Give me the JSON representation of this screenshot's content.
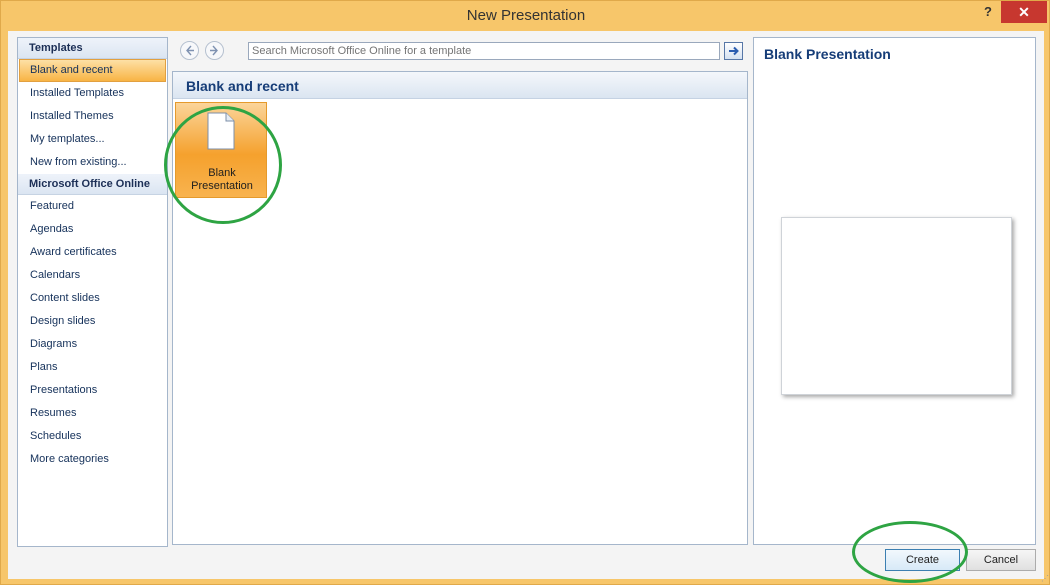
{
  "window": {
    "title": "New Presentation",
    "help_label": "?",
    "close_label": "✕"
  },
  "sidebar": {
    "section_templates": "Templates",
    "items_local": [
      {
        "label": "Blank and recent",
        "selected": true
      },
      {
        "label": "Installed Templates"
      },
      {
        "label": "Installed Themes"
      },
      {
        "label": "My templates..."
      },
      {
        "label": "New from existing..."
      }
    ],
    "section_online": "Microsoft Office Online",
    "items_online": [
      {
        "label": "Featured"
      },
      {
        "label": "Agendas"
      },
      {
        "label": "Award certificates"
      },
      {
        "label": "Calendars"
      },
      {
        "label": "Content slides"
      },
      {
        "label": "Design slides"
      },
      {
        "label": "Diagrams"
      },
      {
        "label": "Plans"
      },
      {
        "label": "Presentations"
      },
      {
        "label": "Resumes"
      },
      {
        "label": "Schedules"
      },
      {
        "label": "More categories"
      }
    ]
  },
  "toolbar": {
    "back_icon": "arrow-left-icon",
    "forward_icon": "arrow-right-icon",
    "search_placeholder": "Search Microsoft Office Online for a template",
    "search_go_icon": "search-go-arrow-icon"
  },
  "gallery": {
    "heading": "Blank and recent",
    "tiles": [
      {
        "label": "Blank Presentation",
        "icon": "blank-document-icon",
        "selected": true
      }
    ]
  },
  "preview": {
    "title": "Blank Presentation"
  },
  "footer": {
    "create_label": "Create",
    "cancel_label": "Cancel"
  },
  "colors": {
    "accent_orange": "#f5a12d",
    "highlight_ring": "#2ea443",
    "heading_blue": "#163d78",
    "close_red": "#c7372f"
  }
}
